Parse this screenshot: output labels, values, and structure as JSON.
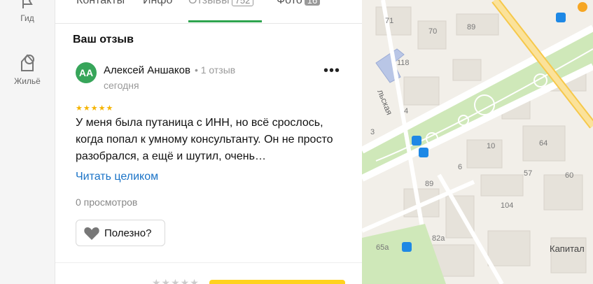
{
  "nav": {
    "guide_label": "Гид",
    "housing_label": "Жильё"
  },
  "tabs": [
    {
      "label": "Контакты"
    },
    {
      "label": "Инфо"
    },
    {
      "label": "Отзывы",
      "badge": "752"
    },
    {
      "label": "Фото",
      "badge": "16"
    }
  ],
  "review": {
    "section_title": "Ваш отзыв",
    "avatar_initials": "АА",
    "author": "Алексей Аншаков",
    "author_meta": "• 1 отзыв",
    "date": "сегодня",
    "rating": 5,
    "rating_stars": "★★★★★",
    "text": "У меня была путаница с ИНН, но всё срослось, когда попал к умному консультанту. Он не просто разобрался, а ещё и шутил, очень…",
    "read_more": "Читать целиком",
    "views": "0 просмотров",
    "useful_label": "Полезно?",
    "more_icon": "more-dots-icon"
  },
  "map": {
    "street_label": "льская",
    "place_label": "Капитал",
    "house_numbers": [
      "71",
      "70",
      "89",
      "118",
      "4",
      "3",
      "10",
      "6",
      "64",
      "57",
      "60",
      "89",
      "104",
      "82а",
      "65а"
    ]
  },
  "colors": {
    "accent_green": "#2ea44f",
    "avatar_bg": "#37a55a",
    "link_blue": "#1a73c7",
    "star": "#f5b400",
    "map_bg": "#f2efe9",
    "park": "#cfe8b9",
    "road_orange": "#f6c84a",
    "bus_stop": "#1e88e5"
  }
}
